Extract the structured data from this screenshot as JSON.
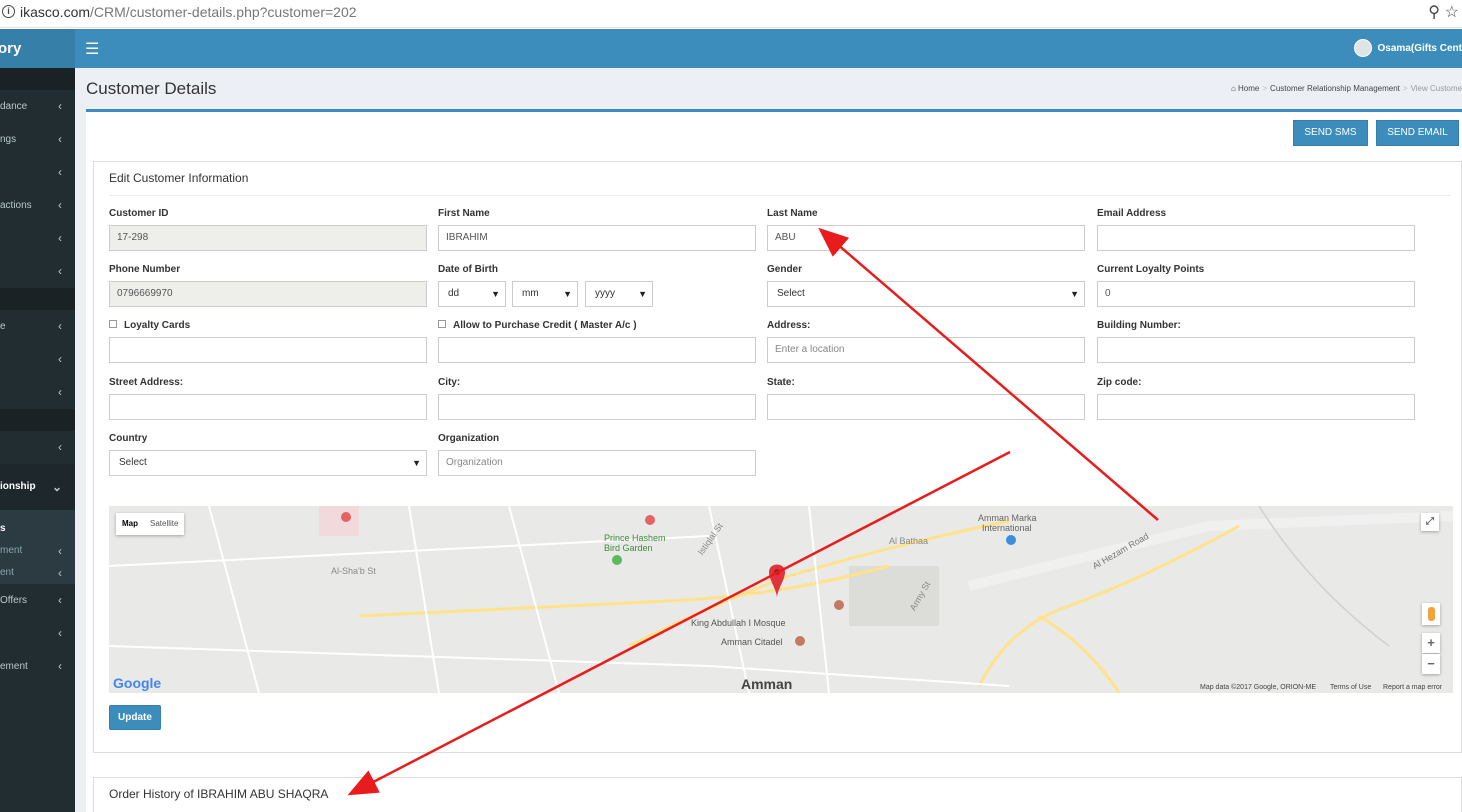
{
  "browser": {
    "url_host": "ikasco.com",
    "url_path": "/CRM/customer-details.php?customer=202"
  },
  "sidebar": {
    "brand": "ory",
    "items": [
      {
        "label": "dance"
      },
      {
        "label": "ngs"
      },
      {
        "label": ""
      },
      {
        "label": "actions"
      },
      {
        "label": ""
      },
      {
        "label": ""
      },
      {
        "label": "e"
      },
      {
        "label": ""
      },
      {
        "label": ""
      },
      {
        "label": ""
      },
      {
        "label": "ionship"
      },
      {
        "label": "s"
      },
      {
        "label": "ment"
      },
      {
        "label": "ent"
      },
      {
        "label": "Offers"
      },
      {
        "label": ""
      },
      {
        "label": "ement"
      }
    ]
  },
  "topnav": {
    "user": "Osama(Gifts Cent"
  },
  "page": {
    "title": "Customer Details",
    "breadcrumb": {
      "home": "Home",
      "crm": "Customer Relationship Management",
      "current": "View Custome"
    }
  },
  "actions": {
    "send_sms": "SEND SMS",
    "send_email": "SEND EMAIL"
  },
  "form": {
    "title": "Edit Customer Information",
    "customer_id": {
      "label": "Customer ID",
      "value": "17-298"
    },
    "first_name": {
      "label": "First Name",
      "value": "IBRAHIM"
    },
    "last_name": {
      "label": "Last Name",
      "value": "ABU"
    },
    "email": {
      "label": "Email Address",
      "value": ""
    },
    "phone": {
      "label": "Phone Number",
      "value": "0796669970"
    },
    "dob": {
      "label": "Date of Birth",
      "day": "dd",
      "month": "mm",
      "year": "yyyy"
    },
    "gender": {
      "label": "Gender",
      "value": "Select"
    },
    "loyalty_points": {
      "label": "Current Loyalty Points",
      "value": "0"
    },
    "loyalty_cards": {
      "label": "Loyalty Cards",
      "value": ""
    },
    "allow_credit": {
      "label": "Allow to Purchase Credit ( Master A/c )",
      "value": ""
    },
    "address": {
      "label": "Address:",
      "placeholder": "Enter a location"
    },
    "building": {
      "label": "Building Number:",
      "value": ""
    },
    "street": {
      "label": "Street Address:",
      "value": ""
    },
    "city": {
      "label": "City:",
      "value": ""
    },
    "state": {
      "label": "State:",
      "value": ""
    },
    "zip": {
      "label": "Zip code:",
      "value": ""
    },
    "country": {
      "label": "Country",
      "value": "Select"
    },
    "organization": {
      "label": "Organization",
      "placeholder": "Organization"
    },
    "update": "Update"
  },
  "map": {
    "tab_map": "Map",
    "tab_satellite": "Satellite",
    "labels": {
      "amman_marka": "Amman Marka",
      "international": "International",
      "prince_hashem": "Prince Hashem",
      "bird_garden": "Bird Garden",
      "king_abdullah": "King Abdullah I Mosque",
      "citadel": "Amman Citadel",
      "amman": "Amman",
      "al_hezam": "Al Hezam Road",
      "al_batha": "Al Bathaa",
      "army_st": "Army St",
      "istiqlal": "Istiqlal St",
      "al_shab": "Al-Sha'b St"
    },
    "logo": "Google",
    "footer_data": "Map data ©2017 Google, ORION-ME",
    "footer_terms": "Terms of Use",
    "footer_report": "Report a map error"
  },
  "orders": {
    "title": "Order History of IBRAHIM ABU SHAQRA"
  },
  "colors": {
    "primary": "#3c8dbc",
    "sidebar": "#222d32",
    "annotation": "#e81c1c"
  }
}
